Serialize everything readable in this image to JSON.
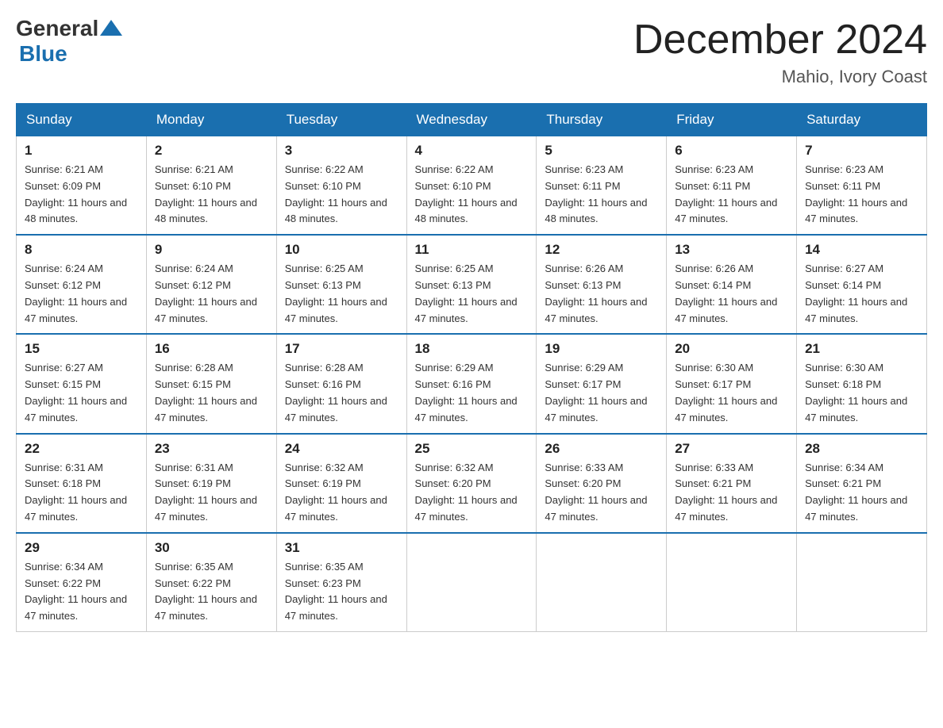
{
  "header": {
    "logo_general": "General",
    "logo_blue": "Blue",
    "month_title": "December 2024",
    "location": "Mahio, Ivory Coast"
  },
  "days_of_week": [
    "Sunday",
    "Monday",
    "Tuesday",
    "Wednesday",
    "Thursday",
    "Friday",
    "Saturday"
  ],
  "weeks": [
    [
      {
        "day": "1",
        "sunrise": "6:21 AM",
        "sunset": "6:09 PM",
        "daylight": "11 hours and 48 minutes."
      },
      {
        "day": "2",
        "sunrise": "6:21 AM",
        "sunset": "6:10 PM",
        "daylight": "11 hours and 48 minutes."
      },
      {
        "day": "3",
        "sunrise": "6:22 AM",
        "sunset": "6:10 PM",
        "daylight": "11 hours and 48 minutes."
      },
      {
        "day": "4",
        "sunrise": "6:22 AM",
        "sunset": "6:10 PM",
        "daylight": "11 hours and 48 minutes."
      },
      {
        "day": "5",
        "sunrise": "6:23 AM",
        "sunset": "6:11 PM",
        "daylight": "11 hours and 48 minutes."
      },
      {
        "day": "6",
        "sunrise": "6:23 AM",
        "sunset": "6:11 PM",
        "daylight": "11 hours and 47 minutes."
      },
      {
        "day": "7",
        "sunrise": "6:23 AM",
        "sunset": "6:11 PM",
        "daylight": "11 hours and 47 minutes."
      }
    ],
    [
      {
        "day": "8",
        "sunrise": "6:24 AM",
        "sunset": "6:12 PM",
        "daylight": "11 hours and 47 minutes."
      },
      {
        "day": "9",
        "sunrise": "6:24 AM",
        "sunset": "6:12 PM",
        "daylight": "11 hours and 47 minutes."
      },
      {
        "day": "10",
        "sunrise": "6:25 AM",
        "sunset": "6:13 PM",
        "daylight": "11 hours and 47 minutes."
      },
      {
        "day": "11",
        "sunrise": "6:25 AM",
        "sunset": "6:13 PM",
        "daylight": "11 hours and 47 minutes."
      },
      {
        "day": "12",
        "sunrise": "6:26 AM",
        "sunset": "6:13 PM",
        "daylight": "11 hours and 47 minutes."
      },
      {
        "day": "13",
        "sunrise": "6:26 AM",
        "sunset": "6:14 PM",
        "daylight": "11 hours and 47 minutes."
      },
      {
        "day": "14",
        "sunrise": "6:27 AM",
        "sunset": "6:14 PM",
        "daylight": "11 hours and 47 minutes."
      }
    ],
    [
      {
        "day": "15",
        "sunrise": "6:27 AM",
        "sunset": "6:15 PM",
        "daylight": "11 hours and 47 minutes."
      },
      {
        "day": "16",
        "sunrise": "6:28 AM",
        "sunset": "6:15 PM",
        "daylight": "11 hours and 47 minutes."
      },
      {
        "day": "17",
        "sunrise": "6:28 AM",
        "sunset": "6:16 PM",
        "daylight": "11 hours and 47 minutes."
      },
      {
        "day": "18",
        "sunrise": "6:29 AM",
        "sunset": "6:16 PM",
        "daylight": "11 hours and 47 minutes."
      },
      {
        "day": "19",
        "sunrise": "6:29 AM",
        "sunset": "6:17 PM",
        "daylight": "11 hours and 47 minutes."
      },
      {
        "day": "20",
        "sunrise": "6:30 AM",
        "sunset": "6:17 PM",
        "daylight": "11 hours and 47 minutes."
      },
      {
        "day": "21",
        "sunrise": "6:30 AM",
        "sunset": "6:18 PM",
        "daylight": "11 hours and 47 minutes."
      }
    ],
    [
      {
        "day": "22",
        "sunrise": "6:31 AM",
        "sunset": "6:18 PM",
        "daylight": "11 hours and 47 minutes."
      },
      {
        "day": "23",
        "sunrise": "6:31 AM",
        "sunset": "6:19 PM",
        "daylight": "11 hours and 47 minutes."
      },
      {
        "day": "24",
        "sunrise": "6:32 AM",
        "sunset": "6:19 PM",
        "daylight": "11 hours and 47 minutes."
      },
      {
        "day": "25",
        "sunrise": "6:32 AM",
        "sunset": "6:20 PM",
        "daylight": "11 hours and 47 minutes."
      },
      {
        "day": "26",
        "sunrise": "6:33 AM",
        "sunset": "6:20 PM",
        "daylight": "11 hours and 47 minutes."
      },
      {
        "day": "27",
        "sunrise": "6:33 AM",
        "sunset": "6:21 PM",
        "daylight": "11 hours and 47 minutes."
      },
      {
        "day": "28",
        "sunrise": "6:34 AM",
        "sunset": "6:21 PM",
        "daylight": "11 hours and 47 minutes."
      }
    ],
    [
      {
        "day": "29",
        "sunrise": "6:34 AM",
        "sunset": "6:22 PM",
        "daylight": "11 hours and 47 minutes."
      },
      {
        "day": "30",
        "sunrise": "6:35 AM",
        "sunset": "6:22 PM",
        "daylight": "11 hours and 47 minutes."
      },
      {
        "day": "31",
        "sunrise": "6:35 AM",
        "sunset": "6:23 PM",
        "daylight": "11 hours and 47 minutes."
      },
      null,
      null,
      null,
      null
    ]
  ]
}
